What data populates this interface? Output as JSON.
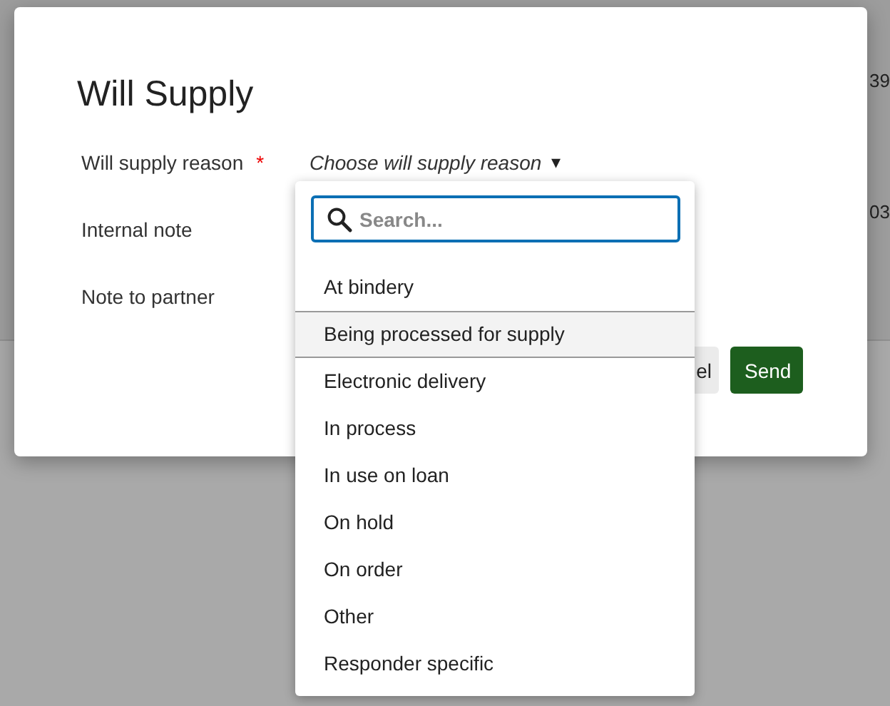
{
  "background": {
    "time_1": "39",
    "time_2": "03"
  },
  "dialog": {
    "title": "Will Supply",
    "fields": [
      {
        "label": "Will supply reason",
        "required_mark": "*",
        "kind": "select",
        "value": "Choose will supply reason",
        "caret": "▾"
      },
      {
        "label": "Internal note",
        "kind": "text"
      },
      {
        "label": "Note to partner",
        "kind": "text"
      }
    ],
    "buttons": [
      {
        "label": "el",
        "kind": "secondary"
      },
      {
        "label": "Send",
        "kind": "primary"
      }
    ]
  },
  "dropdown": {
    "search": {
      "placeholder": "Search..."
    },
    "options": [
      {
        "label": "At bindery",
        "selected": false
      },
      {
        "label": "Being processed for supply",
        "selected": true
      },
      {
        "label": "Electronic delivery",
        "selected": false
      },
      {
        "label": "In process",
        "selected": false
      },
      {
        "label": "In use on loan",
        "selected": false
      },
      {
        "label": "On hold",
        "selected": false
      },
      {
        "label": "On order",
        "selected": false
      },
      {
        "label": "Other",
        "selected": false
      },
      {
        "label": "Responder specific",
        "selected": false
      }
    ]
  }
}
